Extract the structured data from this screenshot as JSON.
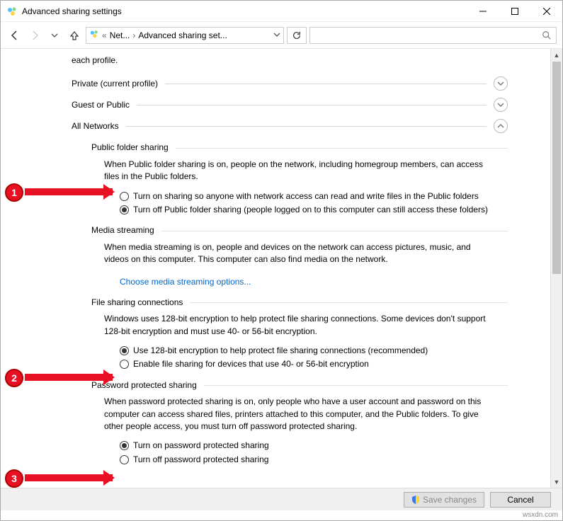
{
  "window": {
    "title": "Advanced sharing settings"
  },
  "nav": {
    "crumb1": "Net...",
    "crumb2": "Advanced sharing set..."
  },
  "intro": "each profile.",
  "profiles": {
    "private": "Private (current profile)",
    "guest": "Guest or Public",
    "all": "All Networks"
  },
  "pfs": {
    "head": "Public folder sharing",
    "desc": "When Public folder sharing is on, people on the network, including homegroup members, can access files in the Public folders.",
    "opt_on": "Turn on sharing so anyone with network access can read and write files in the Public folders",
    "opt_off": "Turn off Public folder sharing (people logged on to this computer can still access these folders)"
  },
  "media": {
    "head": "Media streaming",
    "desc": "When media streaming is on, people and devices on the network can access pictures, music, and videos on this computer. This computer can also find media on the network.",
    "link": "Choose media streaming options..."
  },
  "fsc": {
    "head": "File sharing connections",
    "desc": "Windows uses 128-bit encryption to help protect file sharing connections. Some devices don't support 128-bit encryption and must use 40- or 56-bit encryption.",
    "opt_128": "Use 128-bit encryption to help protect file sharing connections (recommended)",
    "opt_4056": "Enable file sharing for devices that use 40- or 56-bit encryption"
  },
  "pps": {
    "head": "Password protected sharing",
    "desc": "When password protected sharing is on, only people who have a user account and password on this computer can access shared files, printers attached to this computer, and the Public folders. To give other people access, you must turn off password protected sharing.",
    "opt_on": "Turn on password protected sharing",
    "opt_off": "Turn off password protected sharing"
  },
  "footer": {
    "save": "Save changes",
    "cancel": "Cancel"
  },
  "annotations": [
    "1",
    "2",
    "3"
  ],
  "watermark": "wsxdn.com"
}
